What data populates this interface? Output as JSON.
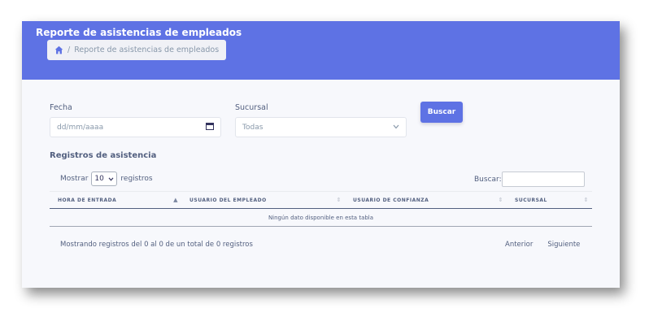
{
  "header": {
    "title": "Reporte de asistencias de empleados",
    "breadcrumb": {
      "current": "Reporte de asistencias de empleados",
      "separator": "/"
    }
  },
  "filters": {
    "date_label": "Fecha",
    "date_placeholder": "dd/mm/aaaa",
    "branch_label": "Sucursal",
    "branch_selected": "Todas",
    "search_button": "Buscar"
  },
  "records": {
    "title": "Registros de asistencia",
    "length_prefix": "Mostrar",
    "length_value": "10",
    "length_suffix": "registros",
    "search_label": "Buscar:",
    "columns": [
      "HORA DE ENTRADA",
      "USUARIO DEL EMPLEADO",
      "USUARIO DE CONFIANZA",
      "SUCURSAL"
    ],
    "empty_message": "Ningún dato disponible en esta tabla",
    "info": "Mostrando registros del 0 al 0 de un total de 0 registros",
    "prev_label": "Anterior",
    "next_label": "Siguiente"
  },
  "colors": {
    "accent": "#5e72e4",
    "background": "#f7f8fc",
    "text": "#525f7f"
  },
  "icons": {
    "breadcrumb": "home-icon",
    "date": "calendar-icon",
    "select": "chevron-down-icon",
    "sort": "sort-icon"
  }
}
